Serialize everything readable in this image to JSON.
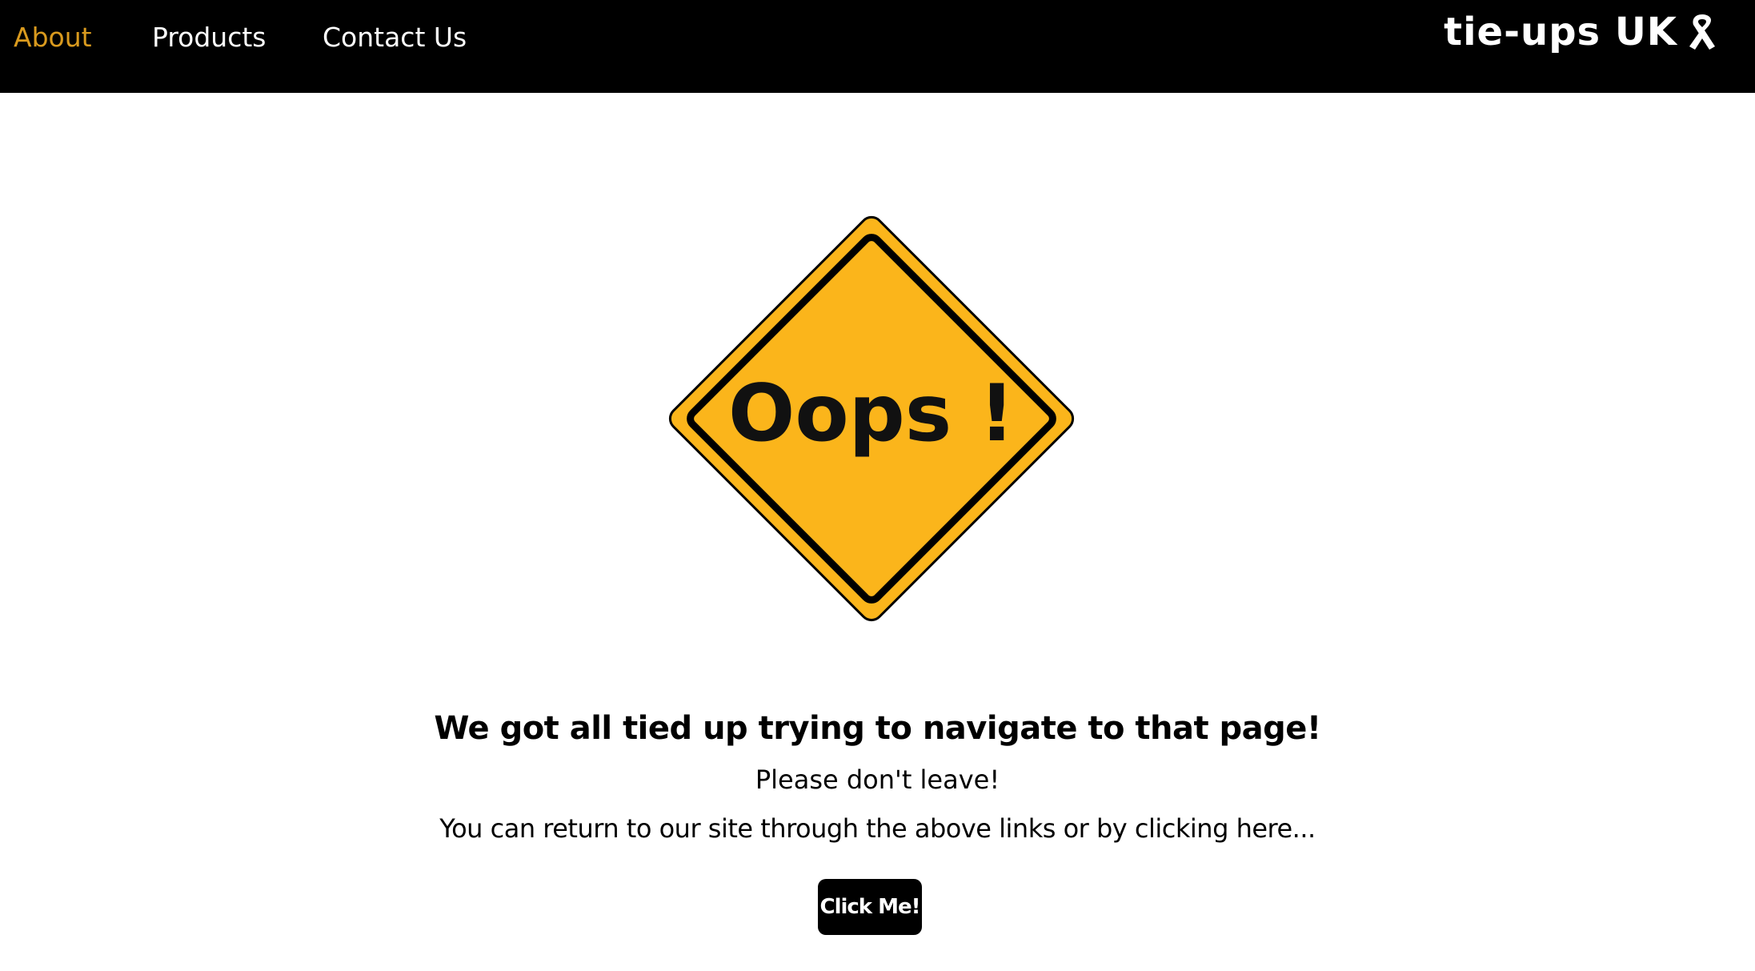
{
  "nav": {
    "links": [
      {
        "label": "About",
        "active": true
      },
      {
        "label": "Products",
        "active": false
      },
      {
        "label": "Contact Us",
        "active": false
      }
    ],
    "brand": "tie-ups UK",
    "brand_icon": "ribbon-icon"
  },
  "sign": {
    "text": "Oops !",
    "icon": "warning-diamond-sign",
    "fill_color": "#fbb51b",
    "border_color": "#000000"
  },
  "main": {
    "headline": "We got all tied up trying to navigate to that page!",
    "line1": "Please don't leave!",
    "line2": "You can return to our site through the above links or by clicking here...",
    "button_label": "Click Me!"
  },
  "colors": {
    "nav_bg": "#000000",
    "nav_text": "#ffffff",
    "nav_active": "#d99a1e"
  }
}
